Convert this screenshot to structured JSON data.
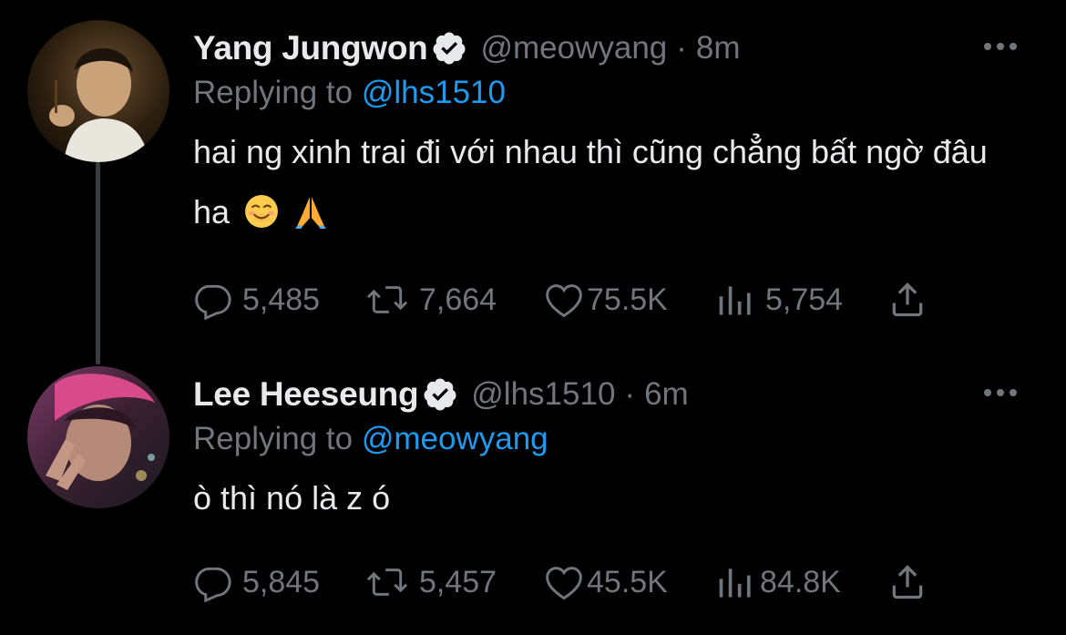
{
  "tweets": [
    {
      "name": "Yang Jungwon",
      "handle": "@meowyang",
      "separator": "·",
      "time": "8m",
      "replying_prefix": "Replying to",
      "replying_to": "@lhs1510",
      "text": "hai ng xinh trai đi với nhau thì cũng chẳng bất ngờ đâu ha",
      "emojis": [
        "smiling-face-emoji",
        "folded-hands-emoji"
      ],
      "replies": "5,485",
      "retweets": "7,664",
      "likes": "75.5K",
      "views": "5,754"
    },
    {
      "name": "Lee Heeseung",
      "handle": "@lhs1510",
      "separator": "·",
      "time": "6m",
      "replying_prefix": "Replying to",
      "replying_to": "@meowyang",
      "text": "ò thì nó là z ó",
      "replies": "5,845",
      "retweets": "5,457",
      "likes": "45.5K",
      "views": "84.8K"
    }
  ],
  "colors": {
    "background": "#000000",
    "text_primary": "#e7e9ea",
    "text_secondary": "#71767b",
    "accent": "#1d9bf0",
    "thread_line": "#3a3d40"
  },
  "icons": [
    "verified-icon",
    "more-icon",
    "reply-icon",
    "retweet-icon",
    "like-icon",
    "views-icon",
    "share-icon"
  ]
}
